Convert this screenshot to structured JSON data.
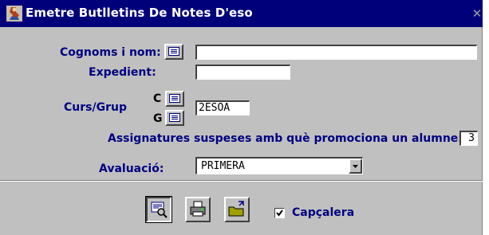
{
  "window": {
    "title": "Emetre Butlletins De Notes D'eso",
    "close_glyph": "✕"
  },
  "form": {
    "cognoms_label": "Cognoms i nom:",
    "cognoms_value": "",
    "expedient_label": "Expedient:",
    "expedient_value": "",
    "cursgrup_label": "Curs/Grup",
    "curs_letter": "C",
    "grup_letter": "G",
    "cursgrup_value": "2ESOA",
    "assignatures_label": "Assignatures suspeses amb què promociona un alumne:",
    "assignatures_value": "3",
    "avaluacio_label": "Avaluació:",
    "avaluacio_value": "PRIMERA"
  },
  "actions": {
    "capcalera_label": "Capçalera",
    "capcalera_checked": true
  },
  "colors": {
    "titlebar": "#00007a",
    "label": "#000080",
    "face": "#c0c0c0"
  },
  "icons": [
    "app-icon",
    "list-icon",
    "preview-icon",
    "printer-icon",
    "export-folder-icon",
    "close-icon",
    "dropdown-arrow-icon",
    "checkmark-icon"
  ]
}
